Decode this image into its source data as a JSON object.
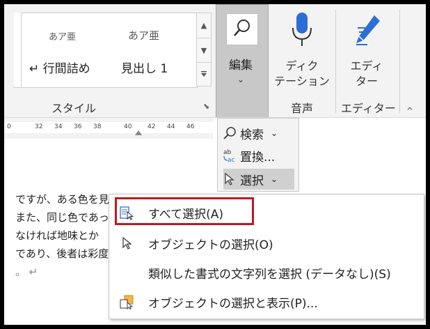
{
  "ribbon": {
    "styles": {
      "preview1": "あア亜",
      "preview2": "あア亜",
      "style1": "↵ 行間詰め",
      "style2": "見出し 1",
      "group_label": "スタイル"
    },
    "edit_button": {
      "label": "編集",
      "chevron": "⌄"
    },
    "dictation": {
      "label_line1": "ディク",
      "label_line2": "テーション",
      "group_label": "音声"
    },
    "editor": {
      "label_line1": "エディ",
      "label_line2": "ター",
      "group_label": "エディター"
    },
    "collapse": "^"
  },
  "ruler": {
    "ticks": [
      "0",
      "32",
      "34",
      "36",
      "38",
      "40",
      "42",
      "44",
      "46"
    ]
  },
  "document": {
    "lines": [
      "ですが、ある色を見ると",
      "また、同じ色であっ",
      "なければ地味とか",
      "であり、後者は彩度",
      "。 ↵"
    ]
  },
  "edit_panel": {
    "find": "検索",
    "replace": "置換...",
    "select": "選択"
  },
  "menu": {
    "items": [
      {
        "label": "すべて選択(A)"
      },
      {
        "label": "オブジェクトの選択(O)"
      },
      {
        "label": "類似した書式の文字列を選択 (データなし)(S)"
      },
      {
        "label": "オブジェクトの選択と表示(P)..."
      }
    ]
  },
  "colors": {
    "highlight": "#c0181e",
    "ribbon_bg": "#f3f3f3",
    "accent_blue": "#2b6fd6"
  }
}
